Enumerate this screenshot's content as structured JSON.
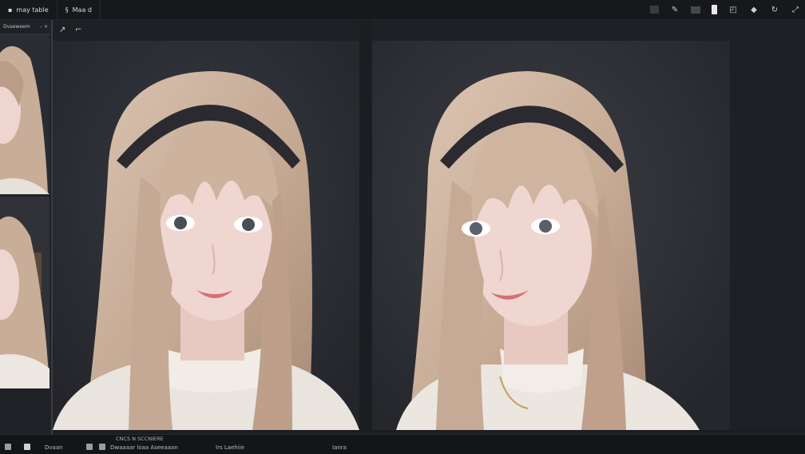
{
  "topbar": {
    "tabs": [
      {
        "label": "may table",
        "icon": "document-icon"
      },
      {
        "label": "Maa  d",
        "icon": "hash-icon"
      }
    ],
    "tools": [
      "layer-icon",
      "brush-icon",
      "grid-icon",
      "page-icon",
      "crop-icon",
      "fill-icon",
      "rotate-icon",
      "expand-icon"
    ]
  },
  "sidebar": {
    "title": "Dvaeweem",
    "close_label": "– ×"
  },
  "left_panel": {
    "tool_icons": [
      "pen-icon",
      "cursor-icon"
    ]
  },
  "statusbar": {
    "caption": "CNCS N SCCNIERE",
    "items": [
      "Dvaan",
      "Dwaaaar loaa  Aseeaaan",
      "Irs Laehiie",
      "Ianra"
    ]
  },
  "colors": {
    "hair": "#c8ad98",
    "skin": "#eed5d0",
    "headband": "#2b2a30",
    "background_dark": "#1c1d21"
  }
}
